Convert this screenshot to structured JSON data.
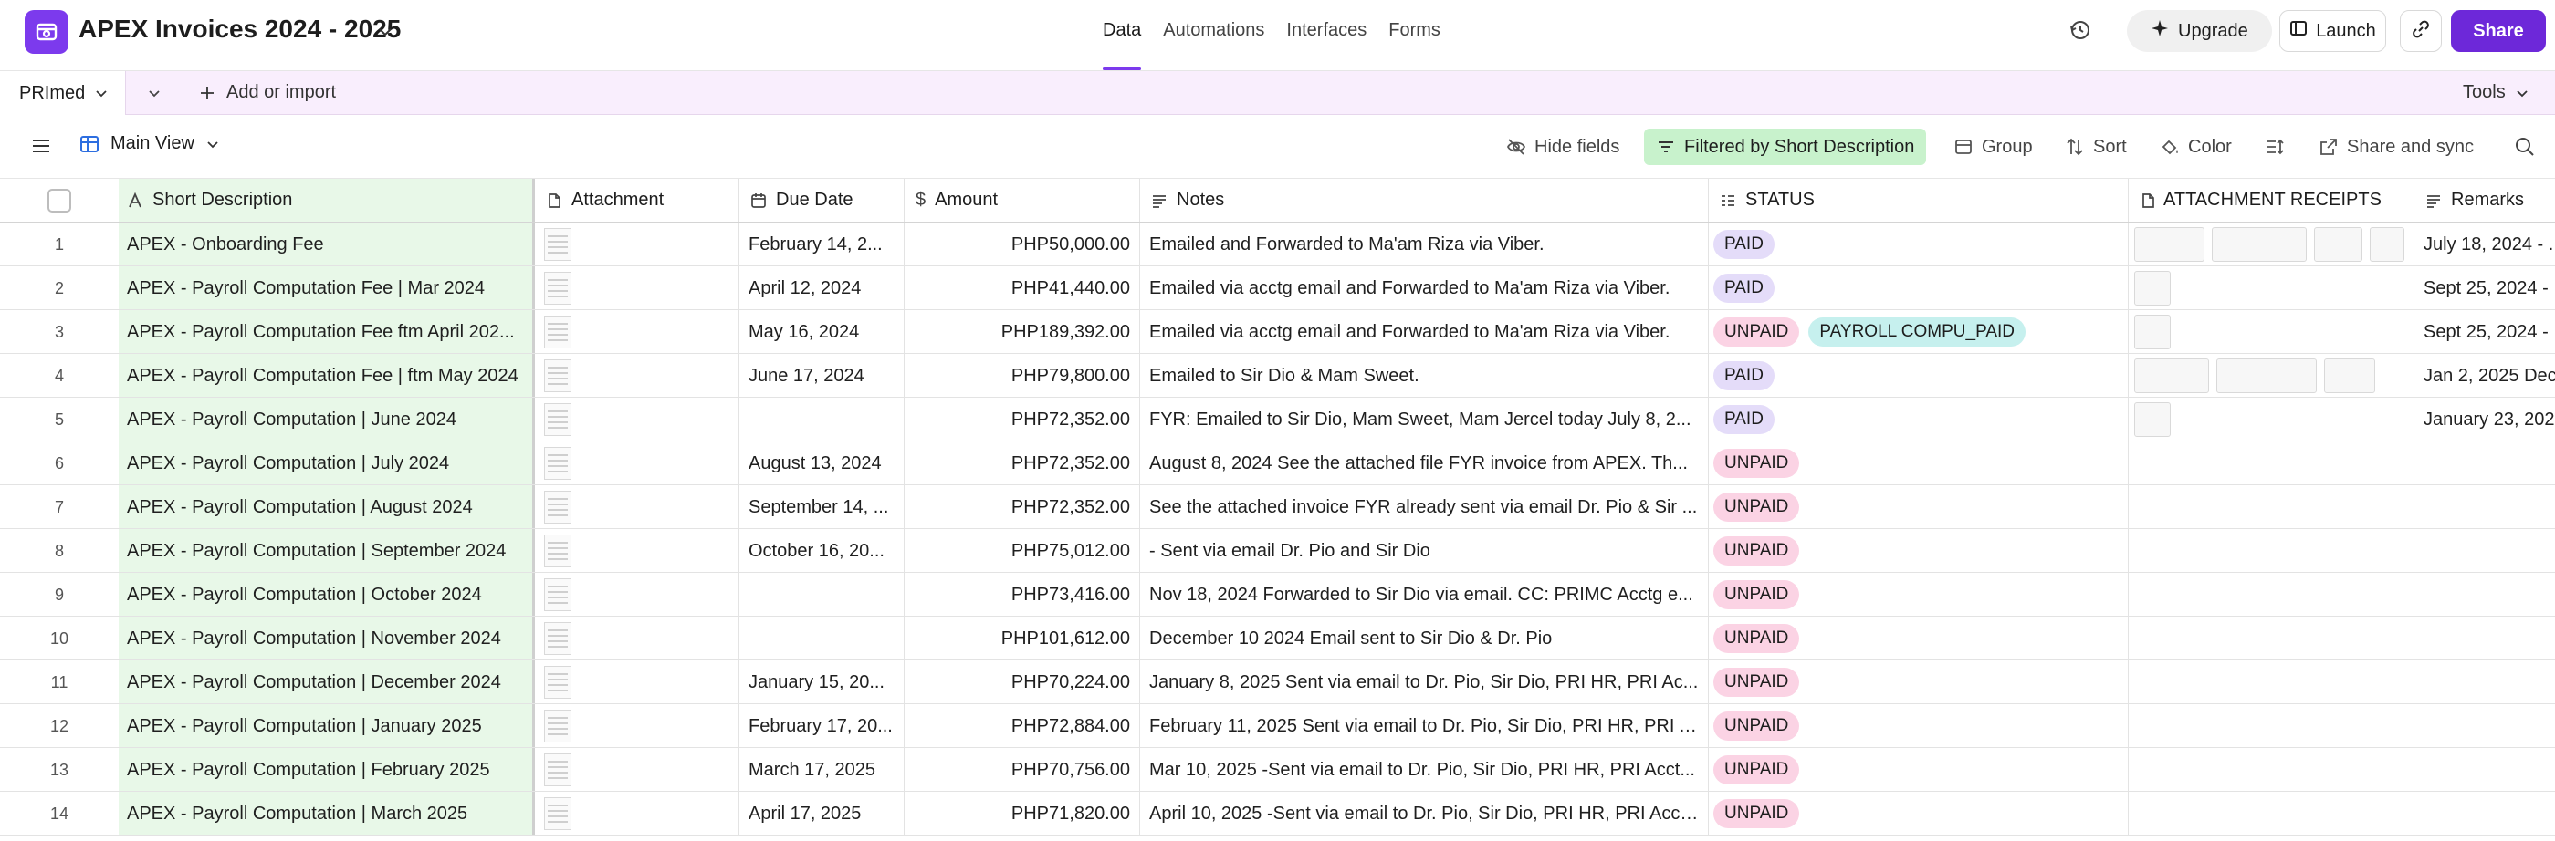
{
  "app": {
    "title": "APEX Invoices 2024 - 2025"
  },
  "nav": {
    "data": "Data",
    "automations": "Automations",
    "interfaces": "Interfaces",
    "forms": "Forms"
  },
  "actions": {
    "upgrade": "Upgrade",
    "launch": "Launch",
    "share": "Share"
  },
  "colors": {
    "accent": "#6d28d9",
    "paid": "#e4dcf9",
    "unpaid": "#fbd3e4",
    "tag_other": "#c6f0ee",
    "filter_bg": "#c8f2cc",
    "primary_col_bg": "#e8f8e8"
  },
  "tabbar": {
    "table_name": "PRImed",
    "add_import": "Add or import",
    "tools": "Tools"
  },
  "viewbar": {
    "view_name": "Main View",
    "hide_fields": "Hide fields",
    "filter": "Filtered by Short Description",
    "group": "Group",
    "sort": "Sort",
    "color": "Color",
    "share_sync": "Share and sync"
  },
  "columns": {
    "short_description": "Short Description",
    "attachment": "Attachment",
    "due_date": "Due Date",
    "amount": "Amount",
    "notes": "Notes",
    "status": "STATUS",
    "attachment_receipts": "ATTACHMENT RECEIPTS",
    "remarks": "Remarks"
  },
  "rows": [
    {
      "num": "1",
      "desc": "APEX - Onboarding Fee",
      "due": "February 14, 2...",
      "amount": "PHP50,000.00",
      "notes": "Emailed and Forwarded to Ma'am Riza via Viber.",
      "status": [
        {
          "label": "PAID",
          "kind": "paid"
        }
      ],
      "receipts": 4,
      "remarks": "July 18, 2024 - ..."
    },
    {
      "num": "2",
      "desc": "APEX - Payroll Computation Fee | Mar 2024",
      "due": "April 12, 2024",
      "amount": "PHP41,440.00",
      "notes": "Emailed via acctg email and Forwarded to Ma'am Riza via Viber.",
      "status": [
        {
          "label": "PAID",
          "kind": "paid"
        }
      ],
      "receipts": 1,
      "remarks": "Sept 25, 2024 - ..."
    },
    {
      "num": "3",
      "desc": "APEX - Payroll Computation Fee ftm April 202...",
      "due": "May 16, 2024",
      "amount": "PHP189,392.00",
      "notes": "Emailed via acctg email and Forwarded to Ma'am Riza via Viber.",
      "status": [
        {
          "label": "UNPAID",
          "kind": "unpaid"
        },
        {
          "label": "PAYROLL COMPU_PAID",
          "kind": "other"
        }
      ],
      "receipts": 1,
      "remarks": "Sept 25, 2024 - ..."
    },
    {
      "num": "4",
      "desc": "APEX - Payroll Computation Fee | ftm May 2024",
      "due": "June 17, 2024",
      "amount": "PHP79,800.00",
      "notes": "Emailed to Sir Dio & Mam Sweet.",
      "status": [
        {
          "label": "PAID",
          "kind": "paid"
        }
      ],
      "receipts": 3,
      "remarks": "Jan 2, 2025 Dec..."
    },
    {
      "num": "5",
      "desc": "APEX - Payroll Computation | June 2024",
      "due": "",
      "amount": "PHP72,352.00",
      "notes": "FYR: Emailed to Sir Dio, Mam Sweet, Mam Jercel today July 8, 2...",
      "status": [
        {
          "label": "PAID",
          "kind": "paid"
        }
      ],
      "receipts": 1,
      "remarks": "January 23, 202..."
    },
    {
      "num": "6",
      "desc": "APEX - Payroll Computation | July 2024",
      "due": "August 13, 2024",
      "amount": "PHP72,352.00",
      "notes": "August 8, 2024 See the attached file FYR invoice from APEX. Th...",
      "status": [
        {
          "label": "UNPAID",
          "kind": "unpaid"
        }
      ],
      "receipts": 0,
      "remarks": ""
    },
    {
      "num": "7",
      "desc": "APEX - Payroll Computation | August 2024",
      "due": "September 14, ...",
      "amount": "PHP72,352.00",
      "notes": "See the attached invoice FYR already sent via email Dr. Pio & Sir ...",
      "status": [
        {
          "label": "UNPAID",
          "kind": "unpaid"
        }
      ],
      "receipts": 0,
      "remarks": ""
    },
    {
      "num": "8",
      "desc": "APEX - Payroll Computation | September 2024",
      "due": "October 16, 20...",
      "amount": "PHP75,012.00",
      "notes": "- Sent via email Dr. Pio and Sir Dio",
      "status": [
        {
          "label": "UNPAID",
          "kind": "unpaid"
        }
      ],
      "receipts": 0,
      "remarks": ""
    },
    {
      "num": "9",
      "desc": "APEX - Payroll Computation | October 2024",
      "due": "",
      "amount": "PHP73,416.00",
      "notes": "Nov 18, 2024 Forwarded to Sir Dio via email. CC: PRIMC Acctg e...",
      "status": [
        {
          "label": "UNPAID",
          "kind": "unpaid"
        }
      ],
      "receipts": 0,
      "remarks": ""
    },
    {
      "num": "10",
      "desc": "APEX - Payroll Computation | November 2024",
      "due": "",
      "amount": "PHP101,612.00",
      "notes": "December 10 2024 Email sent to Sir Dio & Dr. Pio",
      "status": [
        {
          "label": "UNPAID",
          "kind": "unpaid"
        }
      ],
      "receipts": 0,
      "remarks": ""
    },
    {
      "num": "11",
      "desc": "APEX - Payroll Computation | December 2024",
      "due": "January 15, 20...",
      "amount": "PHP70,224.00",
      "notes": "January 8, 2025 Sent via email to Dr. Pio, Sir Dio, PRI HR, PRI Ac...",
      "status": [
        {
          "label": "UNPAID",
          "kind": "unpaid"
        }
      ],
      "receipts": 0,
      "remarks": ""
    },
    {
      "num": "12",
      "desc": "APEX - Payroll Computation | January 2025",
      "due": "February 17, 20...",
      "amount": "PHP72,884.00",
      "notes": "February 11, 2025 Sent via email to Dr. Pio, Sir Dio, PRI HR, PRI A...",
      "status": [
        {
          "label": "UNPAID",
          "kind": "unpaid"
        }
      ],
      "receipts": 0,
      "remarks": ""
    },
    {
      "num": "13",
      "desc": "APEX - Payroll Computation | February 2025",
      "due": "March 17, 2025",
      "amount": "PHP70,756.00",
      "notes": "Mar 10, 2025 -Sent via email to Dr. Pio, Sir Dio, PRI HR, PRI Acct...",
      "status": [
        {
          "label": "UNPAID",
          "kind": "unpaid"
        }
      ],
      "receipts": 0,
      "remarks": ""
    },
    {
      "num": "14",
      "desc": "APEX - Payroll Computation | March 2025",
      "due": "April 17, 2025",
      "amount": "PHP71,820.00",
      "notes": "April 10, 2025 -Sent via email to Dr. Pio, Sir Dio, PRI HR, PRI Acct...",
      "status": [
        {
          "label": "UNPAID",
          "kind": "unpaid"
        }
      ],
      "receipts": 0,
      "remarks": ""
    }
  ],
  "icons": {
    "logo": "base-logo-icon",
    "history": "history-icon",
    "upgrade": "sparkle-icon",
    "launch": "launch-icon",
    "link": "link-icon",
    "menu": "menu-icon",
    "grid": "grid-view-icon",
    "search": "search-icon"
  }
}
